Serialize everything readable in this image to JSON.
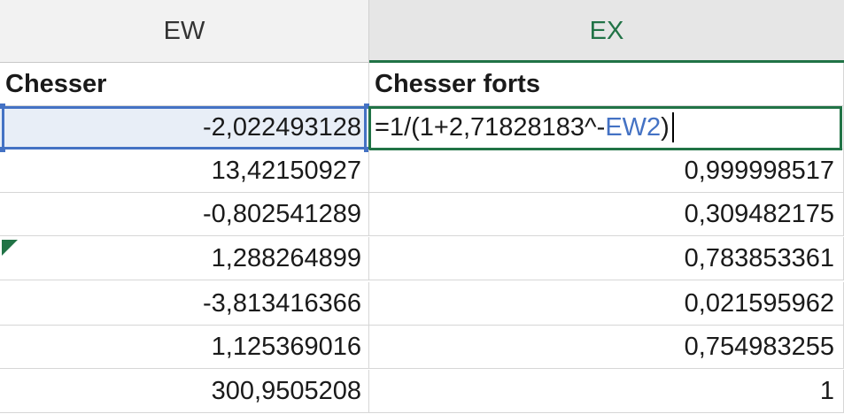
{
  "columns": {
    "ew": "EW",
    "ex": "EX"
  },
  "header_row": {
    "a": "Chesser",
    "b": "Chesser forts"
  },
  "active_cell": {
    "a_value": "-2,022493128",
    "formula_prefix": "=1/(1+2,71828183^-",
    "formula_ref": "EW2",
    "formula_suffix": ")"
  },
  "rows": [
    {
      "a": "13,42150927",
      "b": "0,999998517"
    },
    {
      "a": "-0,802541289",
      "b": "0,309482175"
    },
    {
      "a": "1,288264899",
      "b": "0,783853361"
    },
    {
      "a": "-3,813416366",
      "b": "0,021595962"
    },
    {
      "a": "1,125369016",
      "b": "0,754983255"
    },
    {
      "a": "300,9505208",
      "b": "1"
    }
  ],
  "colors": {
    "accent_green": "#217346",
    "accent_blue": "#4472c4"
  }
}
